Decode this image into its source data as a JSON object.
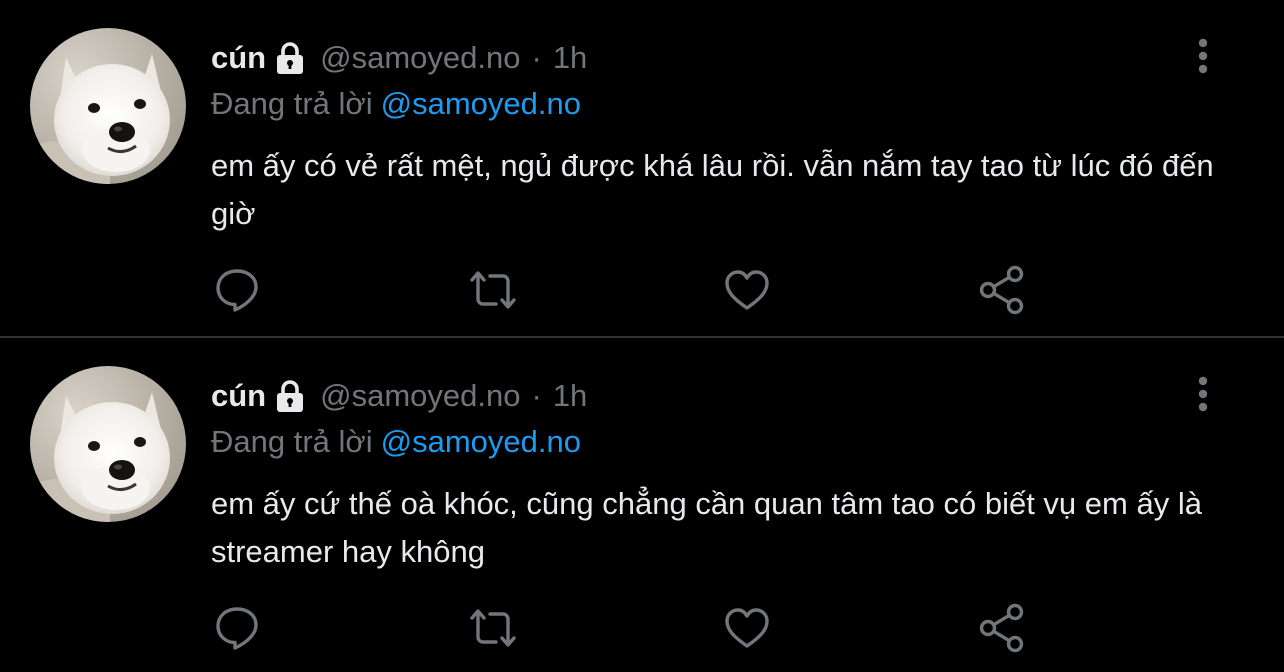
{
  "colors": {
    "background": "#000000",
    "text_primary": "#e7e9ea",
    "text_secondary": "#71767b",
    "accent": "#1d9bf0",
    "divider": "#2f3336"
  },
  "tweets": [
    {
      "author_name": "cún",
      "protected_icon": "lock-icon",
      "handle": "@samoyed.no",
      "separator": "·",
      "time": "1h",
      "reply_prefix": "Đang trả lời",
      "reply_to": "@samoyed.no",
      "text": "em ấy có vẻ rất mệt, ngủ được khá lâu rồi. vẫn nắm tay tao từ lúc đó đến giờ",
      "actions": [
        "reply-icon",
        "retweet-icon",
        "like-icon",
        "share-icon"
      ]
    },
    {
      "author_name": "cún",
      "protected_icon": "lock-icon",
      "handle": "@samoyed.no",
      "separator": "·",
      "time": "1h",
      "reply_prefix": "Đang trả lời",
      "reply_to": "@samoyed.no",
      "text": "em ấy cứ thế oà khóc, cũng chẳng cần quan tâm tao có biết vụ em ấy là streamer hay không",
      "actions": [
        "reply-icon",
        "retweet-icon",
        "like-icon",
        "share-icon"
      ]
    }
  ]
}
